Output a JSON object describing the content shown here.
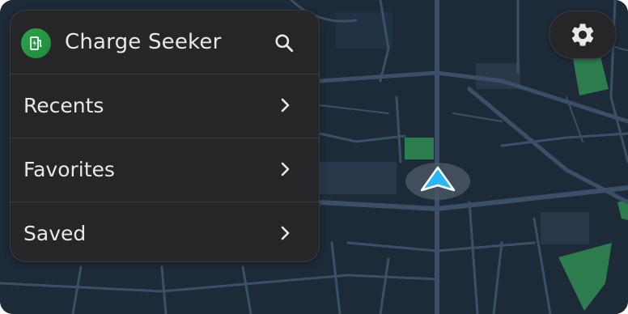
{
  "app": {
    "title": "Charge Seeker",
    "icon": "ev-charger-icon",
    "brand_color": "#2ea34a"
  },
  "header": {
    "search_icon": "search-icon"
  },
  "menu": {
    "items": [
      {
        "label": "Recents",
        "icon": "chevron-right-icon"
      },
      {
        "label": "Favorites",
        "icon": "chevron-right-icon"
      },
      {
        "label": "Saved",
        "icon": "chevron-right-icon"
      }
    ]
  },
  "settings": {
    "icon": "gear-icon"
  },
  "map": {
    "theme": "dark",
    "background_color": "#1d2a38",
    "road_color": "#3b5066",
    "park_color": "#2e7d4f",
    "marker_color": "#29b6f6"
  }
}
